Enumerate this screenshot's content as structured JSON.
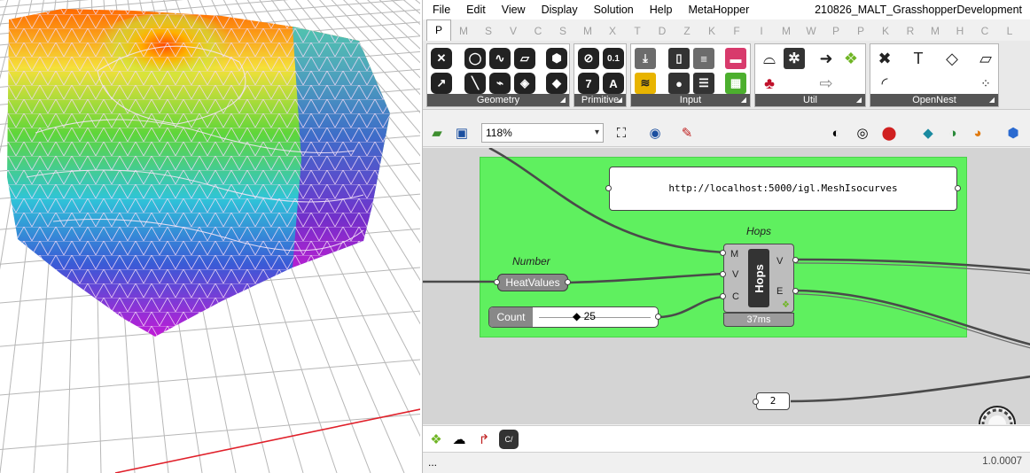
{
  "menu": [
    "File",
    "Edit",
    "View",
    "Display",
    "Solution",
    "Help",
    "MetaHopper"
  ],
  "document_title": "210826_MALT_GrasshopperDevelopment",
  "tabs": [
    "P",
    "M",
    "S",
    "V",
    "C",
    "S",
    "M",
    "X",
    "T",
    "D",
    "Z",
    "K",
    "F",
    "I",
    "M",
    "W",
    "P",
    "P",
    "K",
    "R",
    "M",
    "H",
    "C",
    "L"
  ],
  "active_tab_index": 0,
  "ribbon": {
    "groups": [
      "Geometry",
      "Primitive",
      "Input",
      "Util",
      "OpenNest"
    ],
    "primitive_tools": [
      "0.1",
      "7",
      "A"
    ]
  },
  "toolbar": {
    "zoom": "118%"
  },
  "canvas": {
    "url_panel": "http://localhost:5000/igl.MeshIsocurves",
    "hops": {
      "title": "Hops",
      "core_label": "Hops",
      "inputs": [
        "M",
        "V",
        "C"
      ],
      "outputs": [
        "V",
        "E"
      ],
      "time": "37ms"
    },
    "number": {
      "title": "Number",
      "label": "HeatValues"
    },
    "slider": {
      "name": "Count",
      "value": "25"
    },
    "int_panel": "2"
  },
  "status": {
    "left": "...",
    "version": "1.0.0007"
  },
  "colors": {
    "group_green": "#5ff05f",
    "canvas_grey": "#d4d4d4",
    "ribbon_caption": "#555555"
  }
}
